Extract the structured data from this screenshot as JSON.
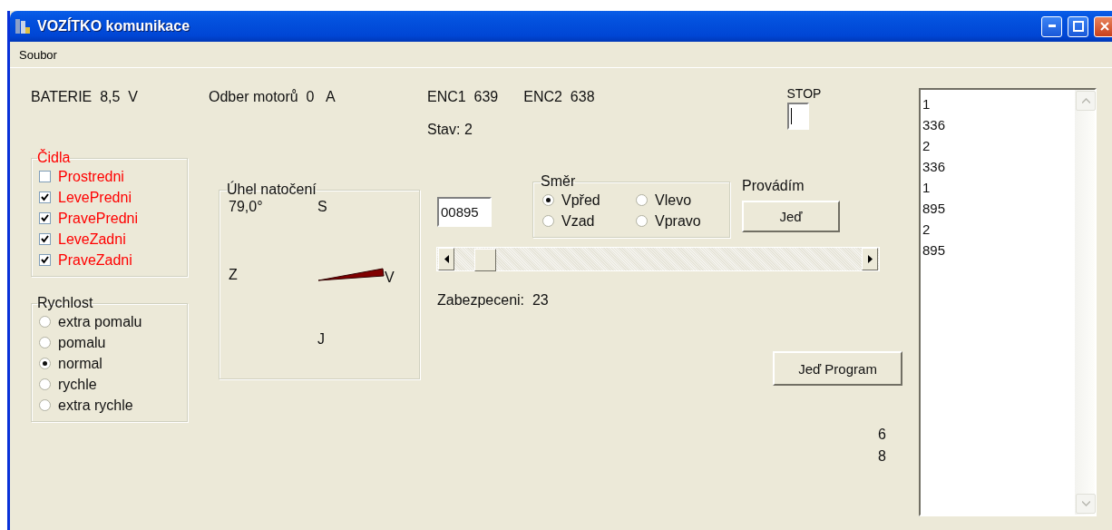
{
  "window": {
    "title": "VOZÍTKO komunikace"
  },
  "menu": [
    "Soubor"
  ],
  "battery": {
    "label": "BATERIE",
    "value": "8,5",
    "unit": "V"
  },
  "motor_current": {
    "label": "Odber motorů",
    "value": "0",
    "unit": "A"
  },
  "encoders": [
    {
      "label": "ENC1",
      "value": "639"
    },
    {
      "label": "ENC2",
      "value": "638"
    }
  ],
  "state": "Stav: 2",
  "stop": {
    "label": "STOP"
  },
  "sensors": {
    "title": "Čidla",
    "items": [
      {
        "label": "Prostredni",
        "checked": false
      },
      {
        "label": "LevePredni",
        "checked": true
      },
      {
        "label": "PravePredni",
        "checked": true
      },
      {
        "label": "LeveZadni",
        "checked": true
      },
      {
        "label": "PraveZadni",
        "checked": true
      }
    ]
  },
  "speed": {
    "title": "Rychlost",
    "options": [
      {
        "label": "extra pomalu",
        "selected": false
      },
      {
        "label": "pomalu",
        "selected": false
      },
      {
        "label": "normal",
        "selected": true
      },
      {
        "label": "rychle",
        "selected": false
      },
      {
        "label": "extra rychle",
        "selected": false
      }
    ]
  },
  "angle": {
    "title": "Úhel natočení",
    "reading": "79,0°",
    "north": "S",
    "west": "Z",
    "east": "V",
    "south": "J"
  },
  "distance_field": {
    "value": "00895"
  },
  "direction": {
    "title": "Směr",
    "options": [
      {
        "label": "Vpřed",
        "selected": true
      },
      {
        "label": "Vlevo",
        "selected": false
      },
      {
        "label": "Vzad",
        "selected": false
      },
      {
        "label": "Vpravo",
        "selected": false
      }
    ]
  },
  "activity_label": "Provádím",
  "go_button": "Jeď",
  "slider": {
    "level": 0.05
  },
  "safety": {
    "label": "Zabezpeceni:",
    "value": "23"
  },
  "program_button": "Jeď Program",
  "counters": [
    "6",
    "8"
  ],
  "log": {
    "lines": [
      "1",
      "336",
      "2",
      "336",
      "1",
      "895",
      "2",
      "895"
    ]
  }
}
